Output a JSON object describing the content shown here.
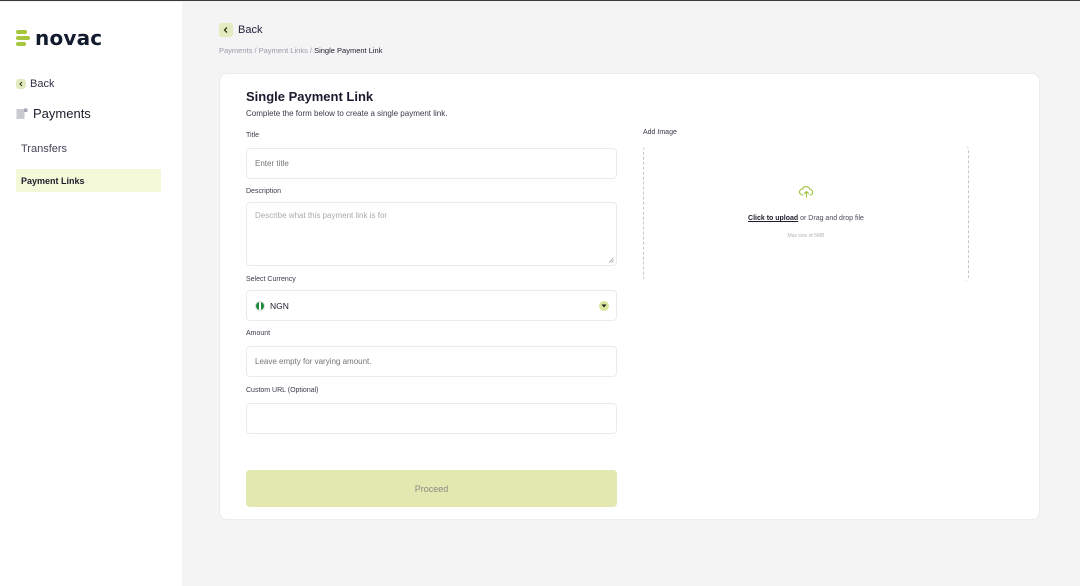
{
  "brand": {
    "name": "novac",
    "accent": "#a6c63c"
  },
  "sidebar": {
    "back_label": "Back",
    "section_title": "Payments",
    "items": [
      {
        "label": "Transfers",
        "active": false
      },
      {
        "label": "Payment Links",
        "active": true
      }
    ]
  },
  "header": {
    "back_label": "Back",
    "breadcrumb": [
      "Payments",
      "Payment Links",
      "Single Payment Link"
    ],
    "breadcrumb_sep": " / "
  },
  "form": {
    "title": "Single Payment Link",
    "subtitle": "Complete the form below to create a single payment link.",
    "title_field": {
      "label": "Title",
      "placeholder": "Enter title",
      "value": ""
    },
    "description_field": {
      "label": "Description",
      "placeholder": "Describe what this payment link is for",
      "value": ""
    },
    "currency_field": {
      "label": "Select Currency",
      "value": "NGN",
      "flag_icon": "nigeria-flag-icon"
    },
    "amount_field": {
      "label": "Amount",
      "placeholder": "Leave empty for varying amount.",
      "value": ""
    },
    "custom_url_field": {
      "label": "Custom URL (Optional)",
      "placeholder": "",
      "value": ""
    },
    "proceed_label": "Proceed"
  },
  "image_upload": {
    "label": "Add Image",
    "upload_link": "Click to upload",
    "upload_rest": "or Drag and drop file",
    "hint": "Max size of 5MB",
    "icon": "cloud-upload-icon"
  }
}
